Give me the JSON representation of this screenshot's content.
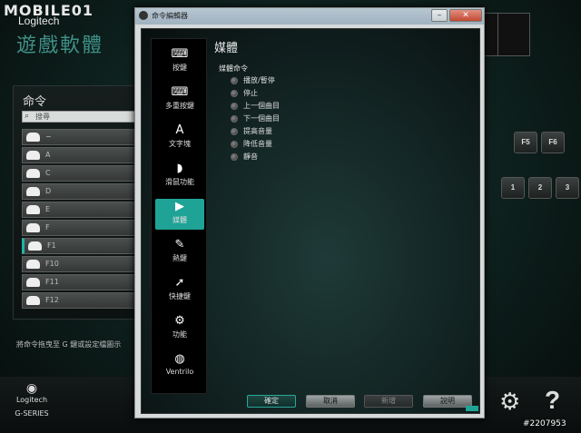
{
  "brand": {
    "name": "MOBILE01",
    "logitech": "Logitech",
    "app_title": "遊戲軟體"
  },
  "commands": {
    "title": "命令",
    "search_placeholder": "搜尋",
    "items": [
      {
        "label": "−"
      },
      {
        "label": "A"
      },
      {
        "label": "C"
      },
      {
        "label": "D"
      },
      {
        "label": "E"
      },
      {
        "label": "F"
      },
      {
        "label": "F1"
      },
      {
        "label": "F10"
      },
      {
        "label": "F11"
      },
      {
        "label": "F12"
      }
    ],
    "hint": "將命令拖曳至 G 鍵或設定檔圖示"
  },
  "keyboard": {
    "keys": [
      "F5",
      "F6",
      "1",
      "2",
      "3"
    ]
  },
  "bottom": {
    "logitech": "Logitech",
    "series": "G-SERIES"
  },
  "watermark": "#2207953",
  "dialog": {
    "title": "命令編輯器",
    "nav": [
      {
        "label": "按鍵",
        "icon": "key-icon"
      },
      {
        "label": "多重按鍵",
        "icon": "multikey-icon"
      },
      {
        "label": "文字塊",
        "icon": "text-block-icon",
        "glyph": "A"
      },
      {
        "label": "滑鼠功能",
        "icon": "mouse-icon"
      },
      {
        "label": "媒體",
        "icon": "media-play-icon",
        "glyph": "▶"
      },
      {
        "label": "熱鍵",
        "icon": "hotkey-icon"
      },
      {
        "label": "快捷鍵",
        "icon": "shortcut-arrow-icon",
        "glyph": "➚"
      },
      {
        "label": "功能",
        "icon": "function-icon"
      },
      {
        "label": "Ventrilo",
        "icon": "headset-icon"
      }
    ],
    "panel_title": "媒體",
    "section_label": "媒體命令",
    "options": [
      "播放/暫停",
      "停止",
      "上一個曲目",
      "下一個曲目",
      "提高音量",
      "降低音量",
      "靜音"
    ],
    "buttons": {
      "ok": "確定",
      "cancel": "取消",
      "new": "新增",
      "help": "說明"
    }
  }
}
